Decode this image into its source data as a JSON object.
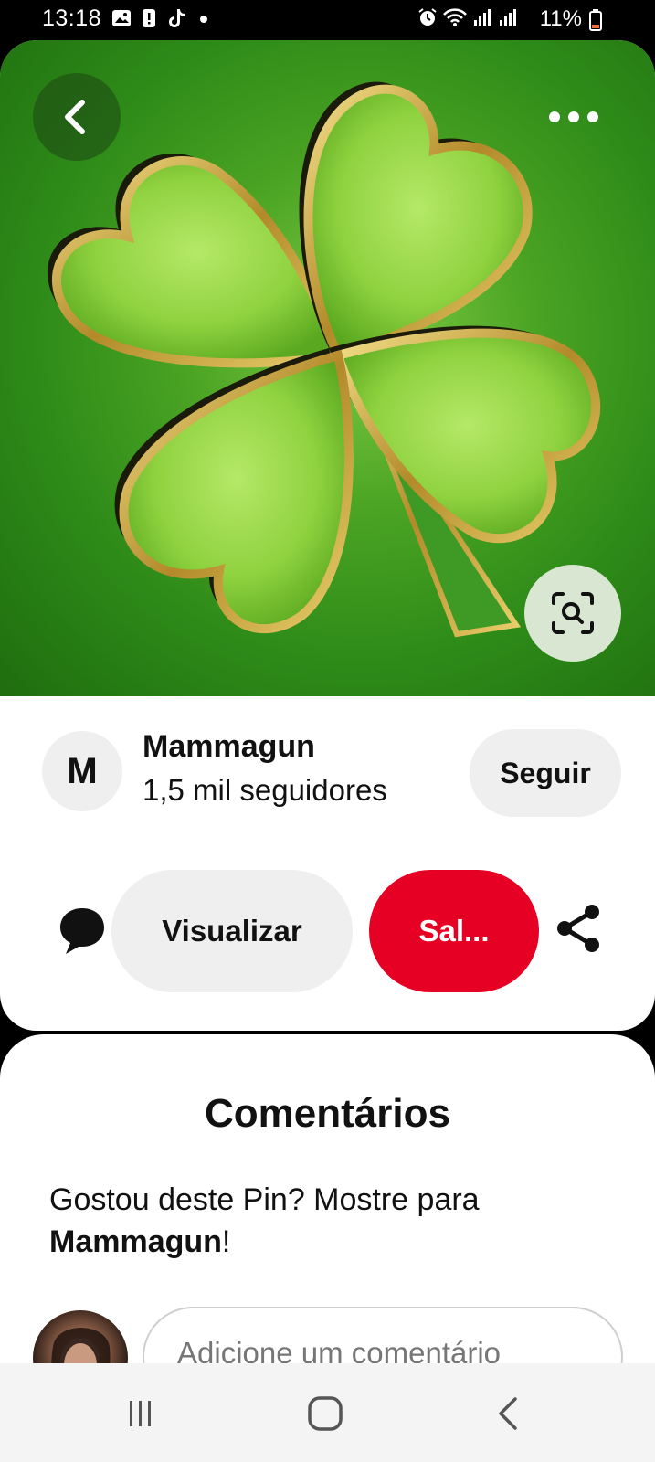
{
  "status_bar": {
    "time": "13:18",
    "battery": "11%",
    "left_icons": [
      "image-icon",
      "alert-icon",
      "tiktok-icon",
      "dot-icon"
    ],
    "right_icons": [
      "alarm-icon",
      "wifi-icon",
      "signal-icon",
      "signal-icon",
      "battery-icon"
    ]
  },
  "pin": {
    "image": "four-leaf-clover",
    "back_icon": "chevron-left-icon",
    "more_icon": "more-horizontal-icon",
    "lens_icon": "visual-search-icon"
  },
  "creator": {
    "avatar_letter": "M",
    "name": "Mammagun",
    "followers": "1,5 mil seguidores",
    "follow_label": "Seguir"
  },
  "actions": {
    "comment_icon": "speech-bubble-icon",
    "view_label": "Visualizar",
    "save_label": "Sal...",
    "share_icon": "share-icon",
    "save_color": "#e60023"
  },
  "comments": {
    "title": "Comentários",
    "prompt_prefix": "Gostou deste Pin? Mostre para ",
    "prompt_name": "Mammagun",
    "prompt_suffix": "!",
    "input_placeholder": "Adicione um comentário"
  },
  "nav_bar": {
    "buttons": [
      "recents-icon",
      "home-icon",
      "back-icon"
    ]
  }
}
